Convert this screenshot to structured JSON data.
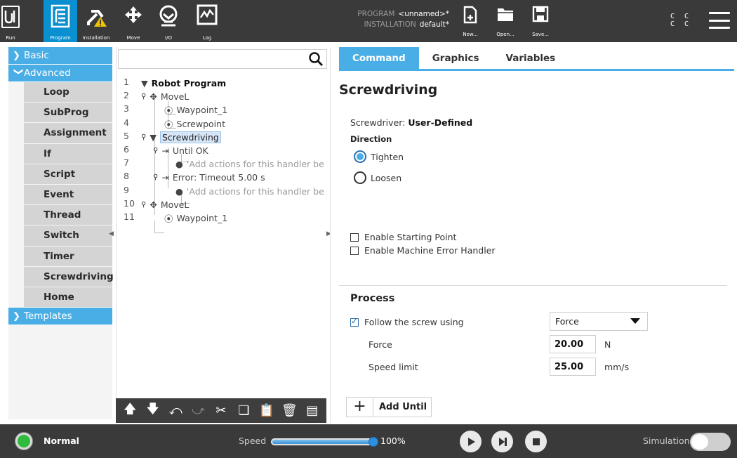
{
  "topbar": {
    "tabs": [
      {
        "label": "Run",
        "icon": "ur-logo-icon"
      },
      {
        "label": "Program",
        "icon": "program-tree-icon",
        "active": true
      },
      {
        "label": "Installation",
        "icon": "installation-warning-icon"
      },
      {
        "label": "Move",
        "icon": "move-arrows-icon"
      },
      {
        "label": "I/O",
        "icon": "io-icon"
      },
      {
        "label": "Log",
        "icon": "log-chart-icon"
      }
    ],
    "program_key": "PROGRAM",
    "program_value": "<unnamed>*",
    "installation_key": "INSTALLATION",
    "installation_value": "default*",
    "file_buttons": [
      {
        "label": "New...",
        "icon": "new-file-icon"
      },
      {
        "label": "Open...",
        "icon": "open-folder-icon"
      },
      {
        "label": "Save...",
        "icon": "save-disk-icon"
      }
    ],
    "cc_top": "C C",
    "cc_bottom": "C C"
  },
  "sidebar": {
    "basic_label": "Basic",
    "advanced_label": "Advanced",
    "advanced_items": [
      "Loop",
      "SubProg",
      "Assignment",
      "If",
      "Script",
      "Event",
      "Thread",
      "Switch",
      "Timer",
      "Screwdriving",
      "Home"
    ],
    "templates_label": "Templates"
  },
  "tree": {
    "search_placeholder": "",
    "rows": [
      {
        "n": "1",
        "text": "Robot Program"
      },
      {
        "n": "2",
        "text": "MoveL"
      },
      {
        "n": "3",
        "text": "Waypoint_1"
      },
      {
        "n": "4",
        "text": "Screwpoint"
      },
      {
        "n": "5",
        "text": "Screwdriving"
      },
      {
        "n": "6",
        "text": "Until OK"
      },
      {
        "n": "7",
        "text": "'Add actions for this handler be"
      },
      {
        "n": "8",
        "text": "Error: Timeout 5.00 s"
      },
      {
        "n": "9",
        "text": "'Add actions for this handler be"
      },
      {
        "n": "10",
        "text": "MoveL"
      },
      {
        "n": "11",
        "text": "Waypoint_1"
      }
    ]
  },
  "right": {
    "tabs": [
      "Command",
      "Graphics",
      "Variables"
    ],
    "title": "Screwdriving",
    "screwdriver_key": "Screwdriver:",
    "screwdriver_value": "User-Defined",
    "direction_label": "Direction",
    "tighten_label": "Tighten",
    "loosen_label": "Loosen",
    "starting_point_label": "Enable Starting Point",
    "machine_error_label": "Enable Machine Error Handler",
    "process_title": "Process",
    "follow_label": "Follow the screw using",
    "follow_method": "Force",
    "force_label": "Force",
    "force_value": "20.00",
    "force_unit": "N",
    "speed_label": "Speed limit",
    "speed_value": "25.00",
    "speed_unit": "mm/s",
    "add_until_label": "Add Until"
  },
  "footer": {
    "status": "Normal",
    "speed_label": "Speed",
    "speed_value": "100%",
    "speed_fraction": 1.0,
    "simulation_label": "Simulation",
    "status_color": "#2fbb3d"
  }
}
